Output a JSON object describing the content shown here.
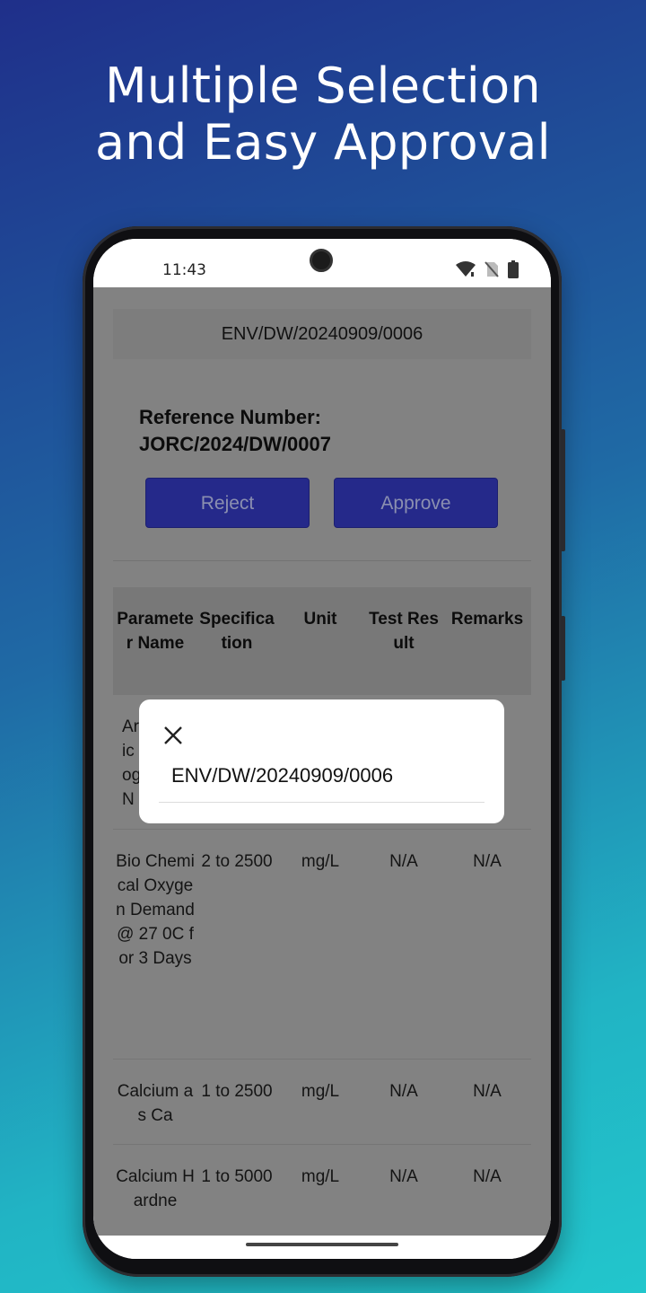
{
  "promo": {
    "headline_line1": "Multiple Selection",
    "headline_line2": "and Easy Approval"
  },
  "status_bar": {
    "time": "11:43",
    "icons": [
      "wifi-icon",
      "no-sim-icon",
      "battery-icon"
    ]
  },
  "screen": {
    "sample_id": "ENV/DW/20240909/0006",
    "reference_label": "Reference Number: JORC/2024/DW/0007",
    "reject_label": "Reject",
    "approve_label": "Approve",
    "button_color": "#25298a"
  },
  "table": {
    "headers": [
      "Parameter Name",
      "Specification",
      "Unit",
      "Test Result",
      "Remarks"
    ],
    "rows": [
      {
        "name": "Ammonical Nitrogen as N",
        "spec": "",
        "unit": "",
        "result": "",
        "remarks": ""
      },
      {
        "name": "Bio Chemical Oxygen Demand @ 27 0C for 3 Days",
        "spec": "2 to 2500",
        "unit": "mg/L",
        "result": "N/A",
        "remarks": "N/A"
      },
      {
        "name": "Calcium as Ca",
        "spec": "1 to 2500",
        "unit": "mg/L",
        "result": "N/A",
        "remarks": "N/A"
      },
      {
        "name": "Calcium Hardne",
        "spec": "1 to 5000",
        "unit": "mg/L",
        "result": "N/A",
        "remarks": "N/A"
      }
    ],
    "row0_partial": [
      "Ar",
      "ic",
      "og",
      "N"
    ]
  },
  "dialog": {
    "title": "ENV/DW/20240909/0006",
    "close_icon": "close-icon"
  }
}
